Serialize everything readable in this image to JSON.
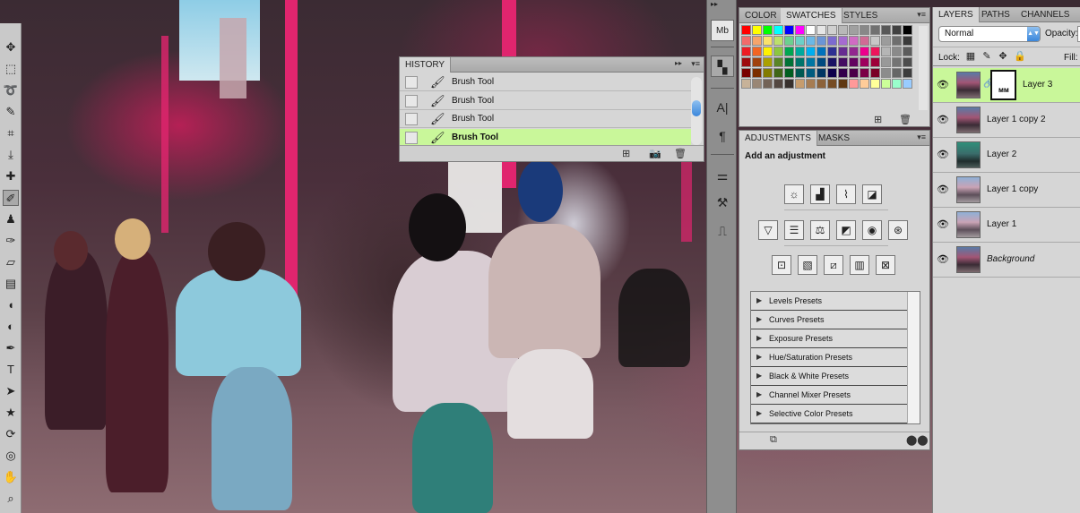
{
  "toolbar": {
    "collapse": "◂◂",
    "tools": [
      {
        "icon": "move-icon",
        "glyph": "✥"
      },
      {
        "icon": "marquee-icon",
        "glyph": "⬚"
      },
      {
        "icon": "lasso-icon",
        "glyph": "➰"
      },
      {
        "icon": "quick-select-icon",
        "glyph": "✎"
      },
      {
        "icon": "crop-icon",
        "glyph": "⌗"
      },
      {
        "icon": "eyedropper-icon",
        "glyph": "⤓"
      },
      {
        "icon": "healing-icon",
        "glyph": "✚"
      },
      {
        "icon": "brush-icon",
        "glyph": "✐"
      },
      {
        "icon": "clone-stamp-icon",
        "glyph": "♟"
      },
      {
        "icon": "history-brush-icon",
        "glyph": "✑"
      },
      {
        "icon": "eraser-icon",
        "glyph": "▱"
      },
      {
        "icon": "gradient-icon",
        "glyph": "▤"
      },
      {
        "icon": "blur-icon",
        "glyph": "◖"
      },
      {
        "icon": "dodge-icon",
        "glyph": "◐"
      },
      {
        "icon": "pen-icon",
        "glyph": "✒"
      },
      {
        "icon": "type-icon",
        "glyph": "T"
      },
      {
        "icon": "path-select-icon",
        "glyph": "➤"
      },
      {
        "icon": "shape-icon",
        "glyph": "★"
      },
      {
        "icon": "3d-rotate-icon",
        "glyph": "⟳"
      },
      {
        "icon": "3d-orbit-icon",
        "glyph": "◎"
      },
      {
        "icon": "hand-icon",
        "glyph": "✋"
      },
      {
        "icon": "zoom-icon",
        "glyph": "⌕"
      }
    ]
  },
  "history": {
    "tab": "HISTORY",
    "double_arrow": "▸▸",
    "menu": "▾≡",
    "items": [
      {
        "label": "Brush Tool"
      },
      {
        "label": "Brush Tool"
      },
      {
        "label": "Brush Tool"
      },
      {
        "label": "Brush Tool"
      }
    ],
    "icons": {
      "brush": "🖌"
    },
    "footer": {
      "new_doc": "⊞",
      "snapshot": "📷",
      "trash": "🗑"
    }
  },
  "strip": {
    "buttons": [
      {
        "name": "mini-bridge-button",
        "glyph": "Mb"
      },
      {
        "name": "history-strip-button",
        "glyph": "▚"
      },
      {
        "name": "character-button",
        "glyph": "A|"
      },
      {
        "name": "paragraph-button",
        "glyph": "¶"
      },
      {
        "name": "brush-presets-button",
        "glyph": "⚌"
      },
      {
        "name": "tool-presets-button",
        "glyph": "⚒"
      },
      {
        "name": "clone-source-button",
        "glyph": "⎍"
      }
    ],
    "top_arrow": "▸▸"
  },
  "swatches": {
    "tabs": [
      "COLOR",
      "SWATCHES",
      "STYLES"
    ],
    "active_tab": "SWATCHES",
    "menu": "▾≡",
    "colors": [
      "#ff0000",
      "#ffff00",
      "#00ff00",
      "#00ffff",
      "#0000ff",
      "#ff00ff",
      "#ffffff",
      "#e6e6e6",
      "#d0d0d0",
      "#b8b8b8",
      "#a0a0a0",
      "#888888",
      "#707070",
      "#585858",
      "#404040",
      "#000000",
      "#f26b6b",
      "#f5a56b",
      "#f9e26b",
      "#bde06b",
      "#6bd08f",
      "#6bd0c8",
      "#6bb8e6",
      "#6b95d6",
      "#7c6bd0",
      "#a56bd0",
      "#d06bc3",
      "#d06b95",
      "#c7c7c7",
      "#9c9c9c",
      "#6e6e6e",
      "#3a3a3a",
      "#ed1c24",
      "#f26522",
      "#fff200",
      "#8dc63f",
      "#00a651",
      "#00a99d",
      "#00aeef",
      "#0072bc",
      "#2e3192",
      "#662d91",
      "#92278f",
      "#ec008c",
      "#ed145b",
      "#b5b5b5",
      "#8a8a8a",
      "#5c5c5c",
      "#9e0b0f",
      "#a0410d",
      "#aba000",
      "#598527",
      "#007236",
      "#00746b",
      "#0076a3",
      "#004a80",
      "#1b1464",
      "#440e62",
      "#630460",
      "#9e005d",
      "#9e0039",
      "#999999",
      "#747474",
      "#4d4d4d",
      "#790000",
      "#7b2e00",
      "#827b00",
      "#406618",
      "#005e20",
      "#005952",
      "#005b7f",
      "#003663",
      "#0d004c",
      "#32004b",
      "#4b0049",
      "#7b0046",
      "#7a0026",
      "#8c8c8c",
      "#666666",
      "#3d3d3d",
      "#c7b299",
      "#998675",
      "#736357",
      "#534741",
      "#37302d",
      "#c69c6d",
      "#a67c52",
      "#8c6239",
      "#754c24",
      "#603913",
      "#ff9999",
      "#ffcc99",
      "#ffff99",
      "#ccff99",
      "#99ffcc",
      "#99ccff"
    ],
    "footer": {
      "new": "⊞",
      "trash": "🗑"
    }
  },
  "adjustments": {
    "tabs": [
      "ADJUSTMENTS",
      "MASKS"
    ],
    "active_tab": "ADJUSTMENTS",
    "menu": "▾≡",
    "title": "Add an adjustment",
    "row1": [
      {
        "name": "brightness-contrast-icon",
        "glyph": "☼"
      },
      {
        "name": "levels-icon",
        "glyph": "▟"
      },
      {
        "name": "curves-icon",
        "glyph": "⌇"
      },
      {
        "name": "exposure-icon",
        "glyph": "◪"
      }
    ],
    "row2": [
      {
        "name": "vibrance-icon",
        "glyph": "▽"
      },
      {
        "name": "hue-saturation-icon",
        "glyph": "☰"
      },
      {
        "name": "color-balance-icon",
        "glyph": "⚖"
      },
      {
        "name": "black-white-icon",
        "glyph": "◩"
      },
      {
        "name": "photo-filter-icon",
        "glyph": "◉"
      },
      {
        "name": "channel-mixer-icon",
        "glyph": "⊛"
      }
    ],
    "row3": [
      {
        "name": "invert-icon",
        "glyph": "⊡"
      },
      {
        "name": "posterize-icon",
        "glyph": "▧"
      },
      {
        "name": "threshold-icon",
        "glyph": "⧄"
      },
      {
        "name": "gradient-map-icon",
        "glyph": "▥"
      },
      {
        "name": "selective-color-icon",
        "glyph": "⊠"
      }
    ],
    "presets": [
      {
        "label": "Levels Presets"
      },
      {
        "label": "Curves Presets"
      },
      {
        "label": "Exposure Presets"
      },
      {
        "label": "Hue/Saturation Presets"
      },
      {
        "label": "Black & White Presets"
      },
      {
        "label": "Channel Mixer Presets"
      },
      {
        "label": "Selective Color Presets"
      }
    ],
    "arrow": "▶",
    "footer": {
      "return": "⧉",
      "clip": "⬤⬤"
    }
  },
  "layers": {
    "tabs": [
      "LAYERS",
      "PATHS",
      "CHANNELS"
    ],
    "active_tab": "LAYERS",
    "blend_mode": "Normal",
    "blend_arrow": "▲▼",
    "opacity_label": "Opacity:",
    "lock_label": "Lock:",
    "lock_icons": [
      "▦",
      "✎",
      "✥",
      "🔒"
    ],
    "fill_label": "Fill:",
    "eye": "👁",
    "chain": "🔗",
    "mask_mark": "ᴍᴍ",
    "items": [
      {
        "name": "Layer 3",
        "selected": true,
        "mask": true
      },
      {
        "name": "Layer 1 copy 2"
      },
      {
        "name": "Layer 2",
        "thumb": "teal"
      },
      {
        "name": "Layer 1 copy",
        "thumb": "light"
      },
      {
        "name": "Layer 1",
        "thumb": "light"
      },
      {
        "name": "Background",
        "italic": true
      }
    ]
  }
}
